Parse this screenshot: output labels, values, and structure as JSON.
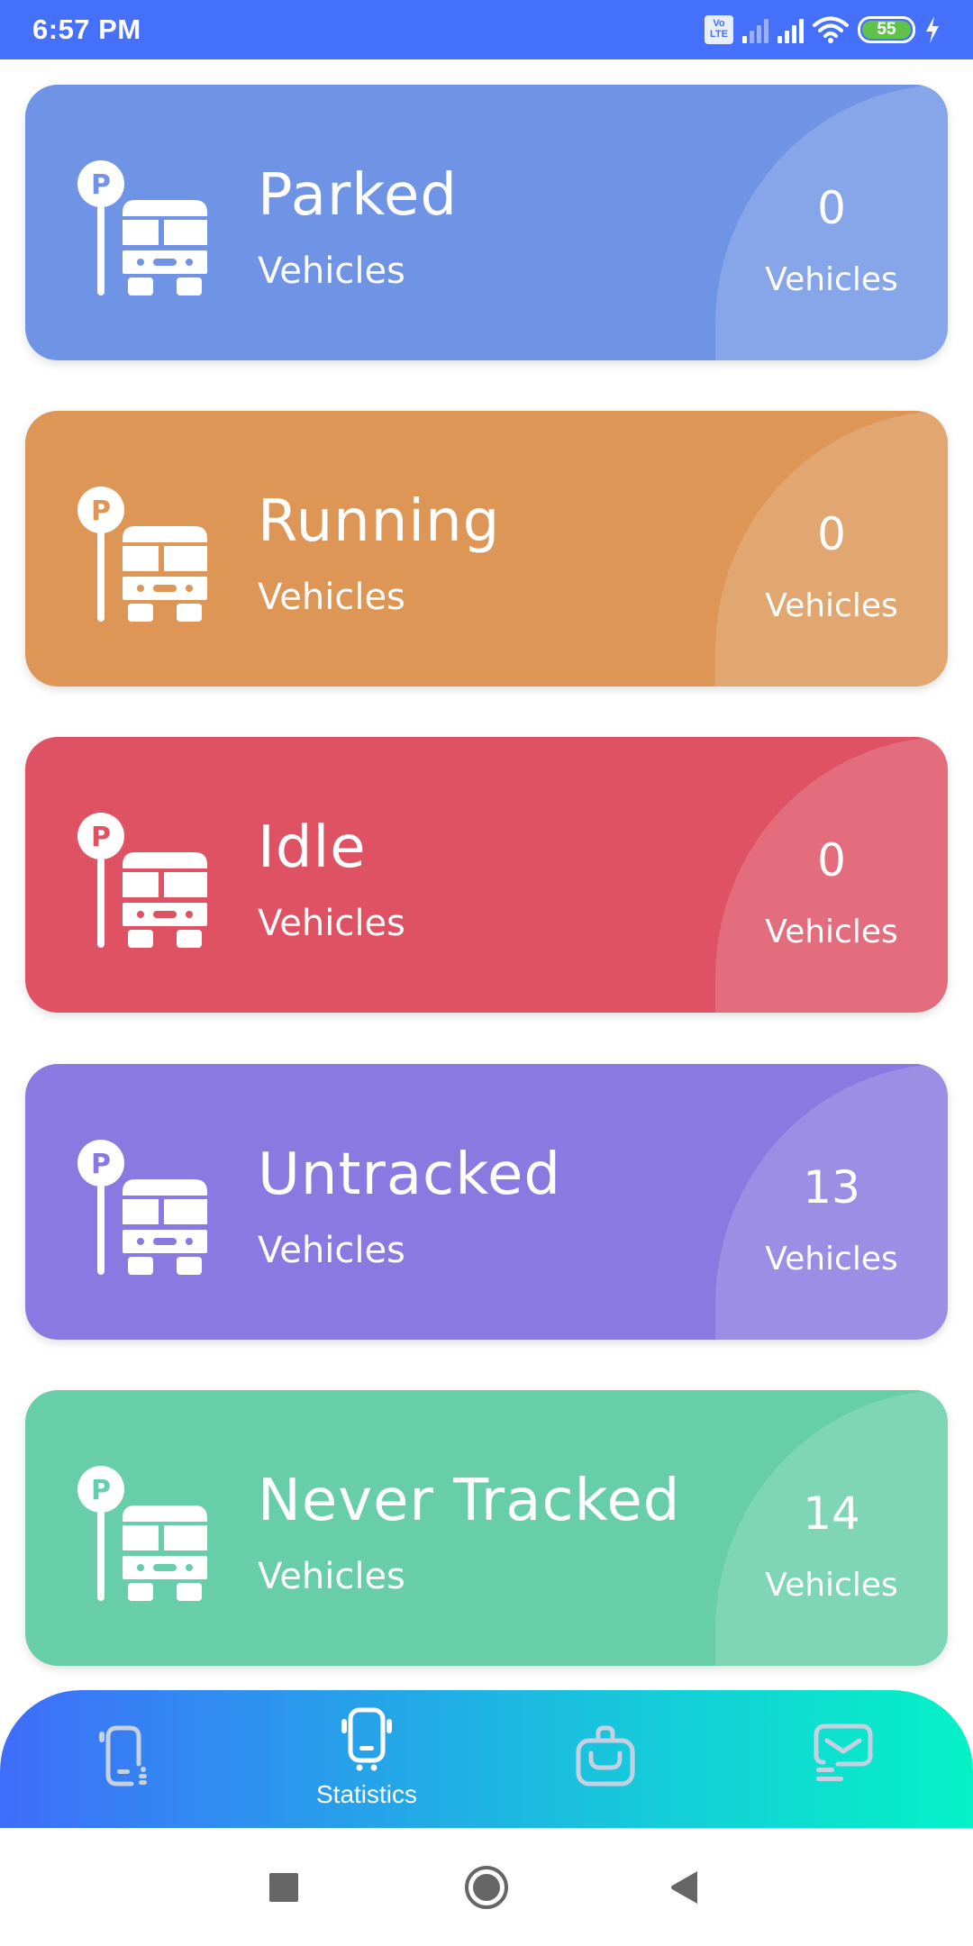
{
  "status_bar": {
    "time": "6:57 PM",
    "volte_label_top": "Vo",
    "volte_label_bottom": "LTE",
    "battery_level": "55",
    "icons": [
      "volte-icon",
      "signal-weak-icon",
      "signal-icon",
      "wifi-icon",
      "battery-icon",
      "charging-icon"
    ]
  },
  "cards": [
    {
      "title": "Parked",
      "subtitle": "Vehicles",
      "count": "0",
      "unit": "Vehicles",
      "color": "#7094e5",
      "icon": "parking-bus-icon"
    },
    {
      "title": "Running",
      "subtitle": "Vehicles",
      "count": "0",
      "unit": "Vehicles",
      "color": "#dd9656",
      "icon": "parking-bus-icon"
    },
    {
      "title": "Idle",
      "subtitle": "Vehicles",
      "count": "0",
      "unit": "Vehicles",
      "color": "#de5263",
      "icon": "parking-bus-icon"
    },
    {
      "title": "Untracked",
      "subtitle": "Vehicles",
      "count": "13",
      "unit": "Vehicles",
      "color": "#8a79e0",
      "icon": "parking-bus-icon"
    },
    {
      "title": "Never Tracked",
      "subtitle": "Vehicles",
      "count": "14",
      "unit": "Vehicles",
      "color": "#67cea9",
      "icon": "parking-bus-icon"
    }
  ],
  "bottom_nav": {
    "items": [
      {
        "icon": "device-list-icon",
        "label": "",
        "active": false
      },
      {
        "icon": "statistics-icon",
        "label": "Statistics",
        "active": true
      },
      {
        "icon": "bag-icon",
        "label": "",
        "active": false
      },
      {
        "icon": "message-icon",
        "label": "",
        "active": false
      }
    ],
    "active_color": "#ffffff",
    "inactive_color": "#c5d0e0"
  },
  "system_nav": {
    "items": [
      "recents-icon",
      "home-icon",
      "back-icon"
    ]
  }
}
